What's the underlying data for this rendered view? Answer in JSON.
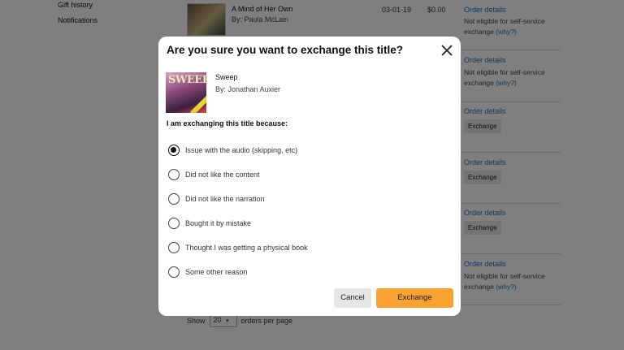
{
  "sidebar": {
    "items": [
      {
        "label": "Gift history"
      },
      {
        "label": "Notifications"
      }
    ]
  },
  "orders": {
    "first_row": {
      "title": "A Mind of Her Own",
      "author": "By: Paula McLain",
      "date": "03-01-19",
      "price": "$0.00"
    },
    "order_details_label": "Order details",
    "not_eligible_text": "Not eligible for self-service exchange",
    "why_label": "(why?)",
    "exchange_label": "Exchange"
  },
  "pagination": {
    "show_label": "Show",
    "per_page_value": "20",
    "suffix_label": "orders per page"
  },
  "modal": {
    "title": "Are you sure you want to exchange this title?",
    "book": {
      "title": "Sweep",
      "author": "By: Jonathan Auxier",
      "cover_text": "SWEEP"
    },
    "reason_label": "I am exchanging this title because:",
    "options": [
      {
        "label": "Issue with the audio (skipping, etc)",
        "selected": true
      },
      {
        "label": "Did not like the content",
        "selected": false
      },
      {
        "label": "Did not like the narration",
        "selected": false
      },
      {
        "label": "Bought it by mistake",
        "selected": false
      },
      {
        "label": "Thought I was getting a physical book",
        "selected": false
      },
      {
        "label": "Some other reason",
        "selected": false
      }
    ],
    "cancel_label": "Cancel",
    "exchange_label": "Exchange"
  },
  "colors": {
    "accent": "#f7a233",
    "link": "#1a73b8",
    "overlay": "rgba(0,0,0,0.5)"
  },
  "icons": {
    "close": "close-icon",
    "chevron": "chevron-down-icon"
  }
}
